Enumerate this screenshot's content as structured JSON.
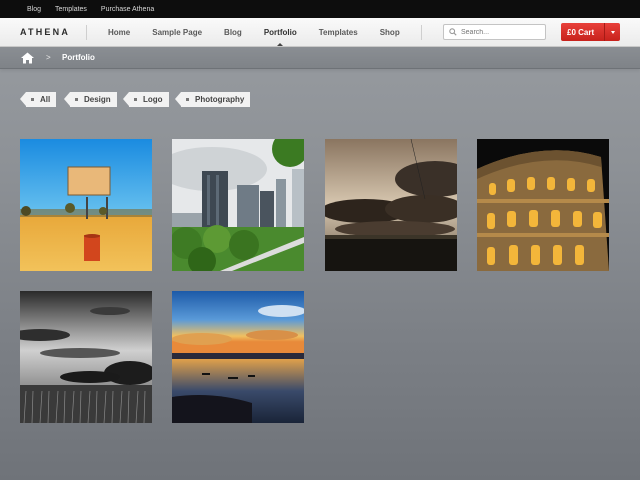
{
  "topbar": {
    "links": [
      "Blog",
      "Templates",
      "Purchase Athena"
    ]
  },
  "header": {
    "logo": "ATHENA",
    "nav": [
      "Home",
      "Sample Page",
      "Blog",
      "Portfolio",
      "Templates",
      "Shop"
    ],
    "active_nav": "Portfolio",
    "search_placeholder": "Search...",
    "cart_label": "£0  Cart"
  },
  "breadcrumb": {
    "separator": ">",
    "current": "Portfolio"
  },
  "filters": [
    "All",
    "Design",
    "Logo",
    "Photography"
  ],
  "gallery": [
    {
      "subject": "billboard in desert"
    },
    {
      "subject": "city skyline with trees"
    },
    {
      "subject": "stormy clouds over field"
    },
    {
      "subject": "colosseum at night"
    },
    {
      "subject": "black and white wheat field"
    },
    {
      "subject": "sunset over lake"
    }
  ],
  "colors": {
    "accent": "#d8302a",
    "topbar": "#0d0d0d",
    "page_bg": "#8d9196"
  }
}
